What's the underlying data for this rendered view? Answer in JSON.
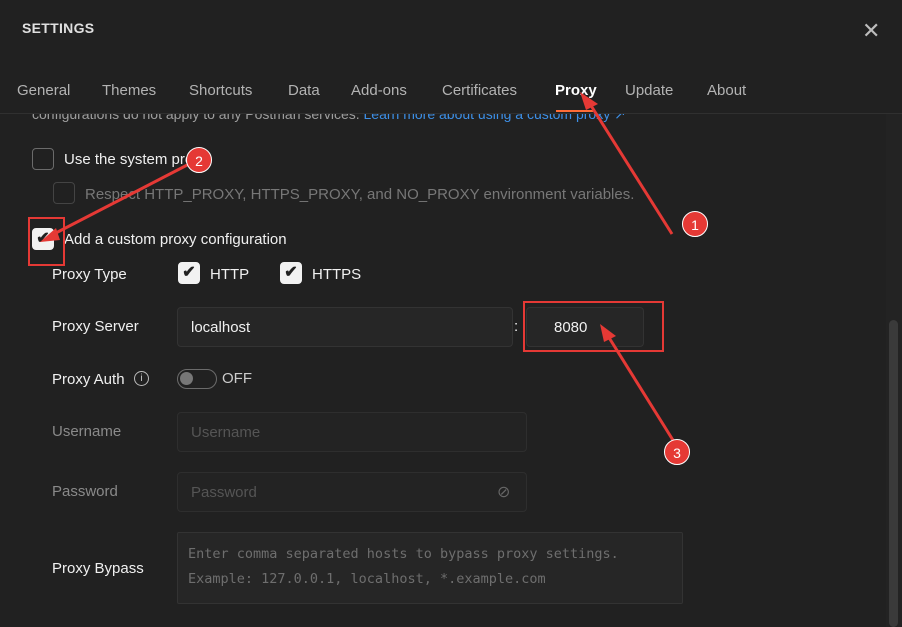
{
  "header": {
    "title": "SETTINGS",
    "close_icon": "close-icon"
  },
  "tabs": [
    {
      "label": "General"
    },
    {
      "label": "Themes"
    },
    {
      "label": "Shortcuts"
    },
    {
      "label": "Data"
    },
    {
      "label": "Add-ons"
    },
    {
      "label": "Certificates"
    },
    {
      "label": "Proxy",
      "active": true
    },
    {
      "label": "Update"
    },
    {
      "label": "About"
    }
  ],
  "intro": {
    "text": "configurations do not apply to any Postman services. ",
    "link": "Learn more about using a custom proxy ↗"
  },
  "system_proxy": {
    "label": "Use the system proxy",
    "checked": false,
    "env_label": "Respect HTTP_PROXY, HTTPS_PROXY, and NO_PROXY environment variables.",
    "env_checked": false
  },
  "custom_proxy": {
    "label": "Add a custom proxy configuration",
    "checked": true
  },
  "proxy_type": {
    "label": "Proxy Type",
    "http": "HTTP",
    "https": "HTTPS",
    "http_checked": true,
    "https_checked": true
  },
  "proxy_server": {
    "label": "Proxy Server",
    "host": "localhost",
    "separator": ":",
    "port": "8080"
  },
  "proxy_auth": {
    "label": "Proxy Auth",
    "state": "OFF",
    "enabled": false
  },
  "username": {
    "label": "Username",
    "placeholder": "Username"
  },
  "password": {
    "label": "Password",
    "placeholder": "Password"
  },
  "bypass": {
    "label": "Proxy Bypass",
    "placeholder_line1": "Enter comma separated hosts to bypass proxy settings.",
    "placeholder_line2": "Example: 127.0.0.1, localhost, *.example.com"
  },
  "annotations": {
    "badge1": "1",
    "badge2": "2",
    "badge3": "3",
    "color": "#e53935"
  },
  "colors": {
    "accent": "#ff6c37",
    "link": "#3d8fe6",
    "background": "#212121"
  }
}
